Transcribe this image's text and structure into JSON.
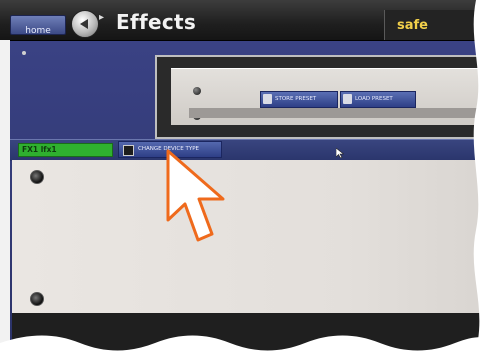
{
  "topbar": {
    "home_label": "home",
    "title": "Effects",
    "status": "safe"
  },
  "rack": {
    "store_preset_label": "STORE PRESET",
    "load_preset_label": "LOAD PRESET"
  },
  "device_bar": {
    "fx_label": "FX1  lfx1",
    "change_device_label": "CHANGE DEVICE TYPE"
  },
  "colors": {
    "accent_status": "#f2d04a",
    "fx_field": "#2fb02f",
    "work_bg": "#323a78"
  }
}
